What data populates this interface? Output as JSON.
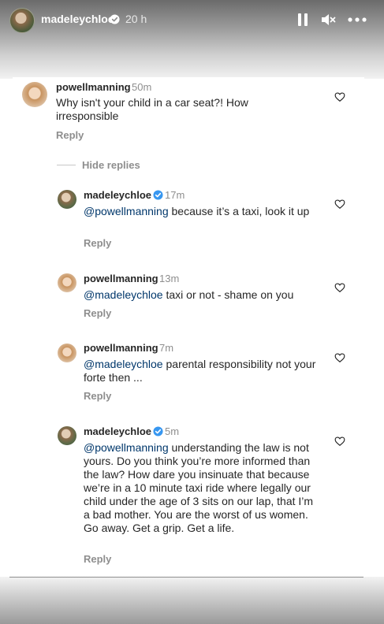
{
  "story": {
    "username": "madeleychloe",
    "time": "20 h"
  },
  "comments": [
    {
      "username": "powellmanning",
      "time": "50m",
      "text": "Why isn't your child in a car seat?! How irresponsible",
      "reply_label": "Reply"
    }
  ],
  "hide_replies_label": "Hide replies",
  "replies": [
    {
      "username": "madeleychloe",
      "time": "17m",
      "mention": "@powellmanning",
      "text": " because it’s a taxi, look it up",
      "reply_label": "Reply"
    },
    {
      "username": "powellmanning",
      "time": "13m",
      "mention": "@madeleychloe",
      "text": " taxi or not - shame on you",
      "reply_label": "Reply"
    },
    {
      "username": "powellmanning",
      "time": "7m",
      "mention": "@madeleychloe",
      "text": " parental responsibility not your forte then ...",
      "reply_label": "Reply"
    },
    {
      "username": "madeleychloe",
      "time": "5m",
      "mention": "@powellmanning",
      "text": " understanding the law is not yours. Do you think you’re more informed than the law? How dare you insinuate that because we’re in a 10 minute taxi ride where legally our child under the age of 3 sits on our lap, that I’m a bad mother. You are the worst of us women. Go away. Get a grip. Get a life.",
      "reply_label": "Reply"
    }
  ],
  "colors": {
    "verified": "#3897f0",
    "mention": "#00376b",
    "muted": "#8e8e8e"
  },
  "icons": {
    "pause": "pause-icon",
    "mute": "mute-icon",
    "more": "more-icon",
    "heart": "heart-icon",
    "verified": "verified-badge-icon"
  }
}
